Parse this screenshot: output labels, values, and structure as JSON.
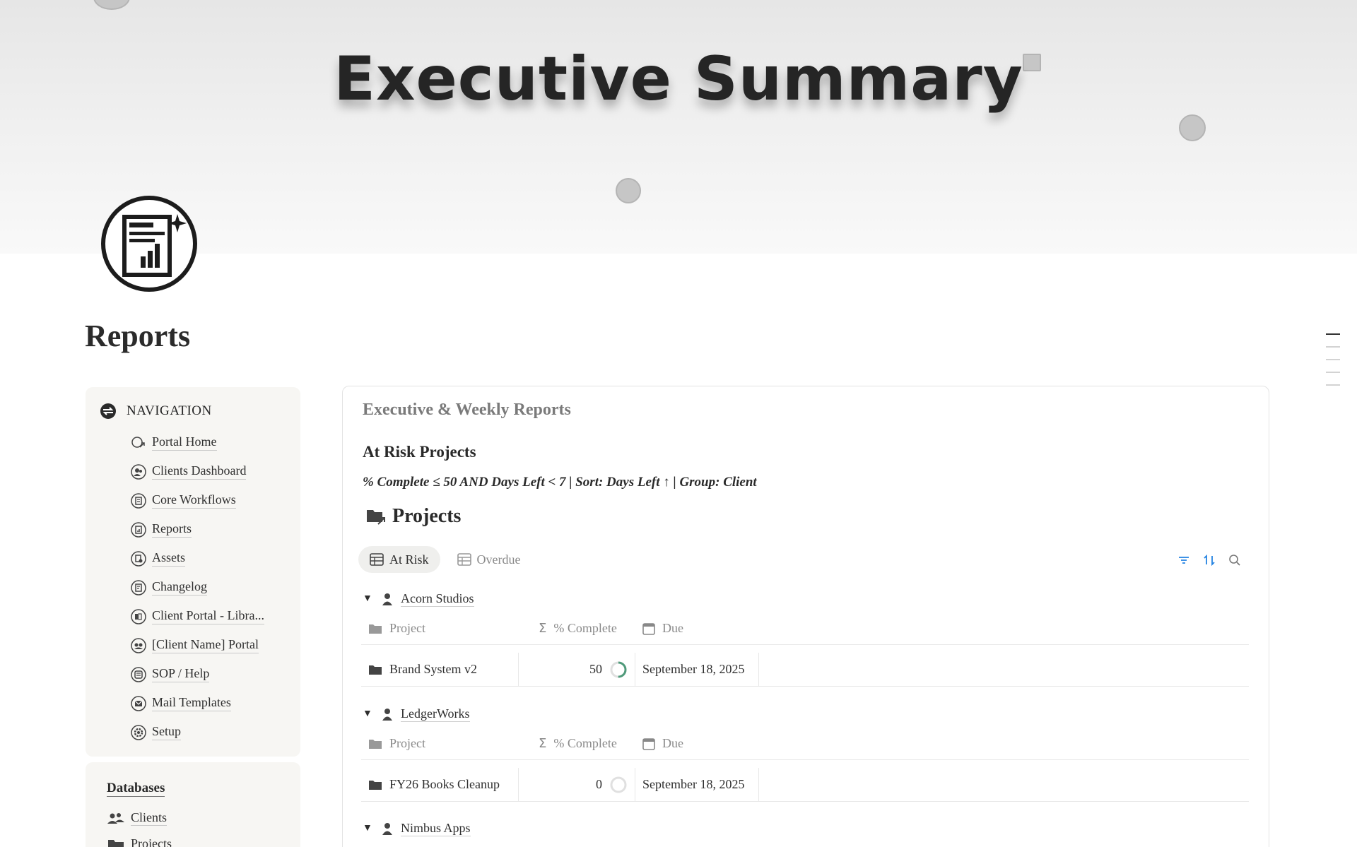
{
  "cover": {
    "title": "Executive Summary"
  },
  "page": {
    "title": "Reports"
  },
  "navigation": {
    "heading": "NAVIGATION",
    "items": [
      {
        "label": "Portal Home",
        "icon": "home-link-icon"
      },
      {
        "label": "Clients Dashboard",
        "icon": "people-icon"
      },
      {
        "label": "Core Workflows",
        "icon": "workflow-icon"
      },
      {
        "label": "Reports",
        "icon": "report-icon"
      },
      {
        "label": "Assets",
        "icon": "assets-icon"
      },
      {
        "label": "Changelog",
        "icon": "changelog-icon"
      },
      {
        "label": "Client Portal - Libra...",
        "icon": "library-icon"
      },
      {
        "label": "[Client Name] Portal",
        "icon": "portal-icon"
      },
      {
        "label": "SOP / Help",
        "icon": "help-icon"
      },
      {
        "label": "Mail Templates",
        "icon": "mail-icon"
      },
      {
        "label": "Setup",
        "icon": "gear-icon"
      }
    ]
  },
  "databases": {
    "heading": "Databases",
    "items": [
      {
        "label": "Clients",
        "icon": "people-icon"
      },
      {
        "label": "Projects",
        "icon": "folder-icon"
      }
    ]
  },
  "main": {
    "section_title": "Executive & Weekly Reports",
    "heading": "At Risk Projects",
    "filter": "% Complete ≤ 50 AND Days Left < 7 | Sort: Days Left ↑ | Group: Client",
    "database_title": "Projects",
    "tabs": [
      {
        "label": "At Risk",
        "active": true
      },
      {
        "label": "Overdue",
        "active": false
      }
    ],
    "columns": {
      "project": "Project",
      "complete": "% Complete",
      "due": "Due"
    },
    "groups": [
      {
        "client": "Acorn Studios",
        "rows": [
          {
            "project": "Brand System v2",
            "complete": "50",
            "complete_fraction": 0.5,
            "due": "September 18, 2025"
          }
        ]
      },
      {
        "client": "LedgerWorks",
        "rows": [
          {
            "project": "FY26 Books Cleanup",
            "complete": "0",
            "complete_fraction": 0,
            "due": "September 18, 2025"
          }
        ]
      },
      {
        "client": "Nimbus Apps",
        "rows": []
      }
    ]
  },
  "colors": {
    "progress": "#4f9a7a",
    "accent": "#2383e2"
  }
}
